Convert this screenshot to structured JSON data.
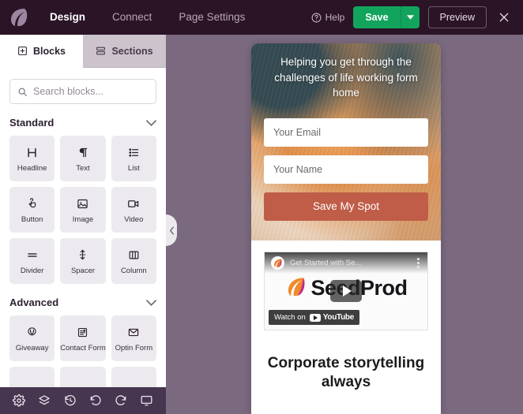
{
  "topbar": {
    "logo_icon": "seedprod-leaf-logo",
    "nav": [
      {
        "label": "Design",
        "active": true
      },
      {
        "label": "Connect",
        "active": false
      },
      {
        "label": "Page Settings",
        "active": false
      }
    ],
    "help_label": "Help",
    "help_icon": "help-circle-icon",
    "save_label": "Save",
    "save_caret_icon": "caret-down-icon",
    "save_color": "#12a45d",
    "preview_label": "Preview",
    "close_icon": "close-x-icon"
  },
  "sidebar": {
    "tabs": [
      {
        "label": "Blocks",
        "icon": "blocks-grid-icon",
        "active": true
      },
      {
        "label": "Sections",
        "icon": "sections-rows-icon",
        "active": false
      }
    ],
    "search": {
      "placeholder": "Search blocks...",
      "value": "",
      "icon": "search-icon"
    },
    "groups": [
      {
        "title": "Standard",
        "chevron_icon": "chevron-down-icon",
        "blocks": [
          {
            "label": "Headline",
            "icon": "headline-h-icon"
          },
          {
            "label": "Text",
            "icon": "paragraph-pilcrow-icon"
          },
          {
            "label": "List",
            "icon": "bullet-list-icon"
          },
          {
            "label": "Button",
            "icon": "button-click-icon"
          },
          {
            "label": "Image",
            "icon": "image-picture-icon"
          },
          {
            "label": "Video",
            "icon": "video-camera-icon"
          },
          {
            "label": "Divider",
            "icon": "divider-lines-icon"
          },
          {
            "label": "Spacer",
            "icon": "spacer-arrows-icon"
          },
          {
            "label": "Column",
            "icon": "column-layout-icon"
          }
        ]
      },
      {
        "title": "Advanced",
        "chevron_icon": "chevron-down-icon",
        "blocks": [
          {
            "label": "Giveaway",
            "icon": "giveaway-trophy-icon"
          },
          {
            "label": "Contact Form",
            "icon": "contact-form-icon"
          },
          {
            "label": "Optin Form",
            "icon": "envelope-icon"
          }
        ]
      }
    ],
    "collapse_handle_icon": "chevron-left-icon",
    "toolbar": [
      {
        "name": "settings",
        "icon": "gear-icon"
      },
      {
        "name": "layers",
        "icon": "layers-icon"
      },
      {
        "name": "revisions",
        "icon": "history-clock-icon"
      },
      {
        "name": "undo",
        "icon": "undo-arrow-icon"
      },
      {
        "name": "redo",
        "icon": "redo-arrow-icon"
      },
      {
        "name": "device-preview",
        "icon": "desktop-monitor-icon"
      }
    ]
  },
  "canvas": {
    "background_color": "#7b6980",
    "preview": {
      "hero": {
        "headline": "Helping you get through the challenges of life working form home",
        "background_image": "ginger-cat-photo",
        "fields": [
          {
            "name": "email",
            "placeholder": "Your Email",
            "value": ""
          },
          {
            "name": "name",
            "placeholder": "Your Name",
            "value": ""
          }
        ],
        "cta_label": "Save My Spot",
        "cta_color": "#bf5d48"
      },
      "video": {
        "title": "Get Started with Se...",
        "channel_icon": "seedprod-channel-avatar",
        "kebab_icon": "more-options-icon",
        "play_icon": "play-button-icon",
        "watch_label": "Watch on",
        "platform": "YouTube",
        "brand_text": "SeedProd"
      },
      "bottom_heading": "Corporate storytelling always"
    }
  }
}
